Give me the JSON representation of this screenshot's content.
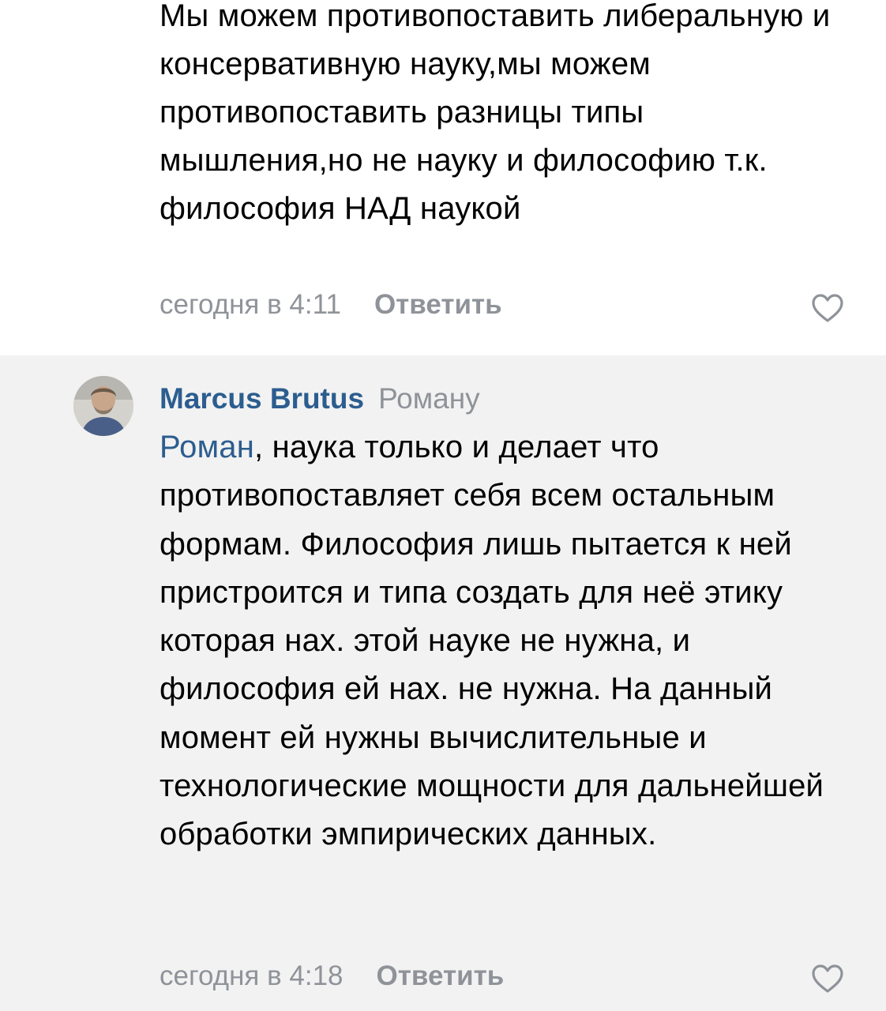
{
  "comment_previous": {
    "text": "Мы можем противопоставить либеральную и консервативную науку,мы можем противопоставить разницы типы мышления,но не науку и философию т.к. философия НАД наукой",
    "timestamp": "сегодня в 4:11",
    "reply_label": "Ответить",
    "like_icon": "heart-outline-icon"
  },
  "comment_current": {
    "author": "Marcus Brutus",
    "recipient": "Роману",
    "mention": "Роман",
    "text": ", наука только и делает что противопоставляет себя всем остальным формам. Философия лишь пытается к ней пристроится и типа создать для неё этику которая нах. этой науке не нужна, и философия ей нах. не нужна. На данный момент ей нужны вычислительные и технологические мощности для дальнейшей обработки эмпирических данных.",
    "timestamp": "сегодня в 4:18",
    "reply_label": "Ответить",
    "like_icon": "heart-outline-icon",
    "avatar": "user-avatar"
  },
  "colors": {
    "link": "#2c5d8f",
    "meta": "#8f9399",
    "background_alt": "#f2f2f2",
    "background": "#ffffff"
  }
}
